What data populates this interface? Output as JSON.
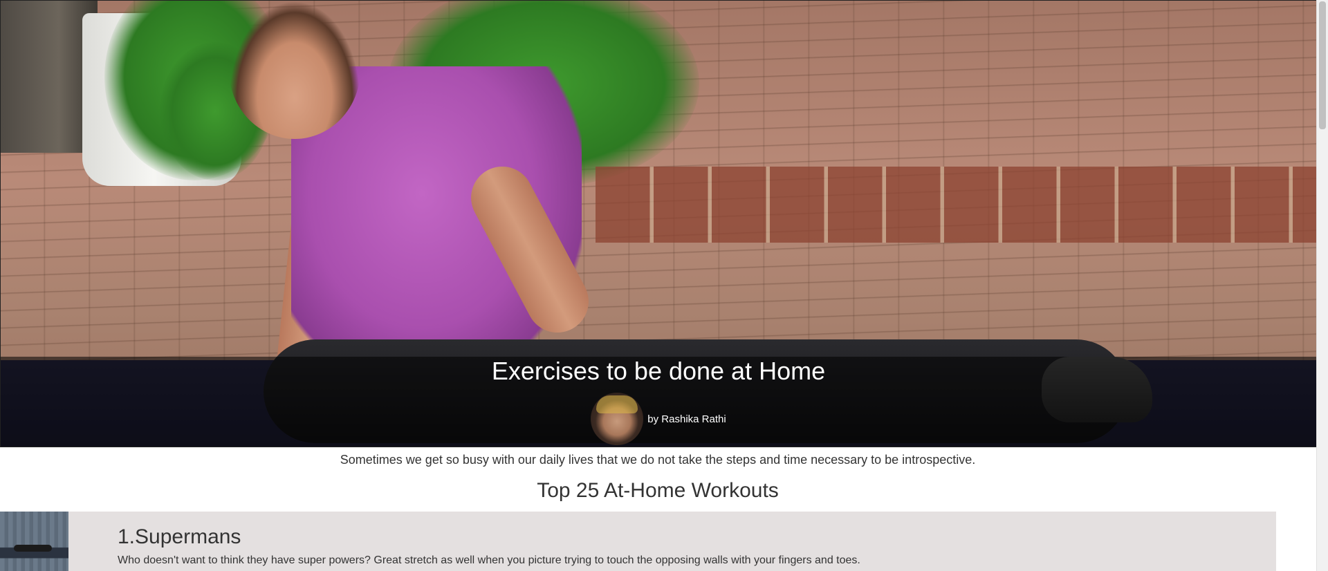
{
  "hero": {
    "title": "Exercises to be done at Home",
    "author": "by Rashika Rathi",
    "avatar_icon": "author-avatar"
  },
  "intro": "Sometimes we get so busy with our daily lives that we do not take the steps and time necessary to be introspective.",
  "section_heading": "Top 25 At-Home Workouts",
  "workouts": [
    {
      "title": "1.Supermans",
      "description": "Who doesn't want to think they have super powers?  Great stretch as well when you picture trying to touch the opposing walls with your fingers and toes."
    }
  ],
  "colors": {
    "card_background": "#e4e0e0",
    "caption_band": "rgba(0,0,0,0.55)",
    "text": "#333333"
  }
}
